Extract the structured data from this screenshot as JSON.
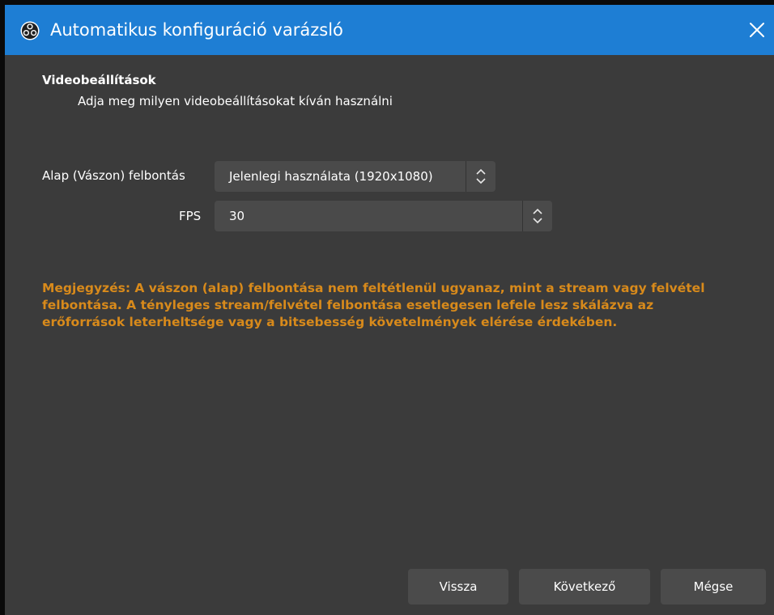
{
  "window": {
    "title": "Automatikus konfiguráció varázsló",
    "app_icon": "obs-logo-icon",
    "close_icon": "close-icon"
  },
  "page": {
    "heading": "Videobeállítások",
    "subheading": "Adja meg milyen videobeállításokat kíván használni"
  },
  "form": {
    "resolution": {
      "label": "Alap (Vászon) felbontás",
      "value": "Jelenlegi használata (1920x1080)"
    },
    "fps": {
      "label": "FPS",
      "value": "30"
    }
  },
  "note": "Megjegyzés: A vászon (alap) felbontása nem feltétlenül ugyanaz, mint a stream vagy felvétel felbontása. A tényleges stream/felvétel felbontása esetlegesen lefele lesz skálázva az erőforrások leterheltsége vagy a bitsebesség követelmények elérése érdekében.",
  "buttons": {
    "back": "Vissza",
    "next": "Következő",
    "cancel": "Mégse"
  },
  "colors": {
    "titlebar": "#1e7ed4",
    "background": "#3b3b3b",
    "control": "#4a4a4a",
    "note_text": "#d88a1b"
  }
}
